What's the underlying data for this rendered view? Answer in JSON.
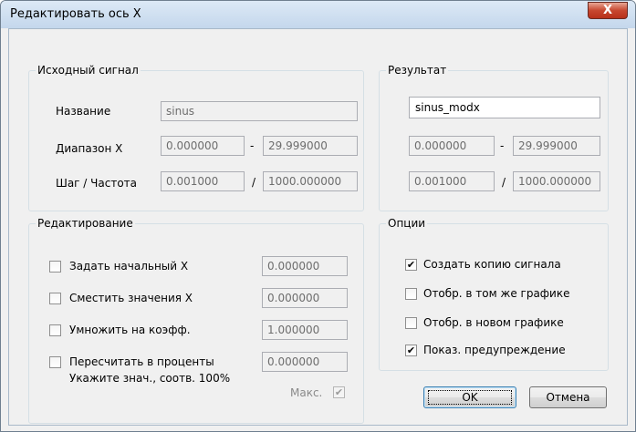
{
  "window": {
    "title": "Редактировать ось X",
    "close_label": "X"
  },
  "source": {
    "group_title": "Исходный сигнал",
    "name_label": "Название",
    "name_value": "sinus",
    "range_label": "Диапазон X",
    "range_from": "0.000000",
    "range_sep": "-",
    "range_to": "29.999000",
    "step_label": "Шаг / Частота",
    "step_value": "0.001000",
    "step_sep": "/",
    "freq_value": "1000.000000"
  },
  "result": {
    "group_title": "Результат",
    "name_value": "sinus_modx",
    "range_from": "0.000000",
    "range_sep": "-",
    "range_to": "29.999000",
    "step_value": "0.001000",
    "step_sep": "/",
    "freq_value": "1000.000000"
  },
  "editing": {
    "group_title": "Редактирование",
    "items": [
      {
        "label": "Задать начальный X",
        "checked": false,
        "value": "0.000000"
      },
      {
        "label": "Сместить значения X",
        "checked": false,
        "value": "0.000000"
      },
      {
        "label": "Умножить на коэфф.",
        "checked": false,
        "value": "1.000000"
      },
      {
        "label": "Пересчитать в проценты",
        "checked": false,
        "value": "0.000000"
      }
    ],
    "hint": "Укажите знач., соотв. 100%",
    "max_label": "Макс.",
    "max_checked": true
  },
  "options": {
    "group_title": "Опции",
    "items": [
      {
        "label": "Создать копию сигнала",
        "checked": true
      },
      {
        "label": "Отобр. в том же графике",
        "checked": false
      },
      {
        "label": "Отобр. в новом графике",
        "checked": false
      },
      {
        "label": "Показ. предупреждение",
        "checked": true
      }
    ]
  },
  "buttons": {
    "ok": "OK",
    "cancel": "Отмена"
  },
  "check_glyph": "✔"
}
